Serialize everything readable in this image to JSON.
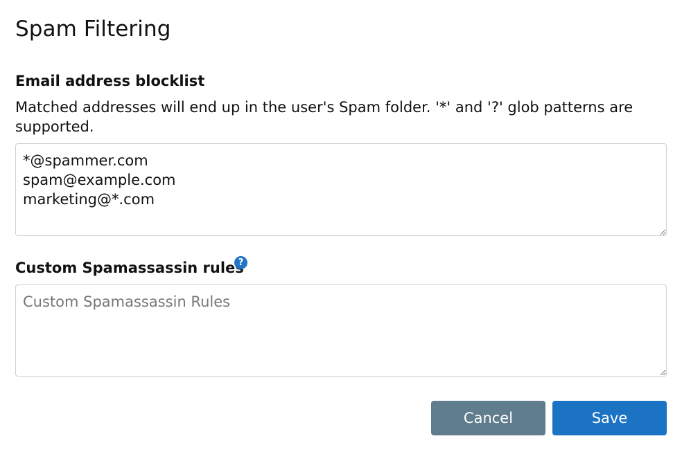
{
  "dialog": {
    "title": "Spam Filtering"
  },
  "blocklist": {
    "label": "Email address blocklist",
    "description": "Matched addresses will end up in the user's Spam folder. '*' and '?' glob patterns are supported.",
    "value": "*@spammer.com\nspam@example.com\nmarketing@*.com"
  },
  "rules": {
    "label": "Custom Spamassassin rules",
    "help_icon": "question-mark",
    "help_glyph": "?",
    "placeholder": "Custom Spamassassin Rules",
    "value": ""
  },
  "actions": {
    "cancel_label": "Cancel",
    "save_label": "Save"
  },
  "colors": {
    "cancel_button": "#5f7d8d",
    "save_button": "#1c73c4",
    "help_icon": "#2474c5"
  }
}
